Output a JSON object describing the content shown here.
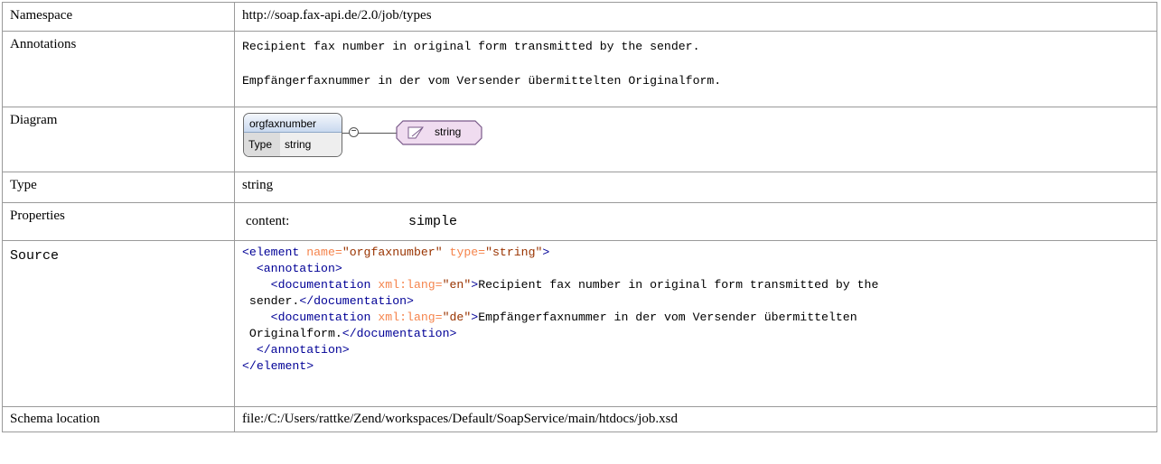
{
  "rows": {
    "namespace": {
      "label": "Namespace",
      "value": "http://soap.fax-api.de/2.0/job/types"
    },
    "annotations": {
      "label": "Annotations",
      "lines": [
        "Recipient fax number in original form transmitted by the sender.",
        "Empfängerfaxnummer in der vom Versender übermittelten Originalform."
      ]
    },
    "diagram": {
      "label": "Diagram",
      "element_name": "orgfaxnumber",
      "type_key": "Type",
      "type_value": "string",
      "connector_symbol": "−",
      "simple_type_name": "string",
      "colors": {
        "element_header": "#c9d9ef",
        "type_box_fill": "#f0dcf0",
        "type_box_border": "#7a5a8a"
      }
    },
    "type": {
      "label": "Type",
      "value": "string"
    },
    "properties": {
      "label": "Properties",
      "key": "content:",
      "value": "simple"
    },
    "source": {
      "label": "Source",
      "colors": {
        "tag": "#000096",
        "attribute": "#f5844c",
        "value": "#993300"
      },
      "line1": {
        "open": "<element",
        "a1": "name=",
        "v1": "\"orgfaxnumber\"",
        "a2": "type=",
        "v2": "\"string\"",
        "close": ">"
      },
      "line2": {
        "indent": "  ",
        "tag": "<annotation>"
      },
      "line3": {
        "indent": "    ",
        "open": "<documentation",
        "attr": "xml:lang=",
        "val": "\"en\"",
        "close": ">",
        "text": "Recipient fax number in original form transmitted by the"
      },
      "line4": {
        "text": " sender.",
        "endtag": "</documentation>"
      },
      "line5": {
        "indent": "    ",
        "open": "<documentation",
        "attr": "xml:lang=",
        "val": "\"de\"",
        "close": ">",
        "text": "Empfängerfaxnummer in der vom Versender übermittelten"
      },
      "line6": {
        "text": " Originalform.",
        "endtag": "</documentation>"
      },
      "line7": {
        "indent": "  ",
        "tag": "</annotation>"
      },
      "line8": {
        "tag": "</element>"
      }
    },
    "schema_location": {
      "label": "Schema location",
      "value": "file:/C:/Users/rattke/Zend/workspaces/Default/SoapService/main/htdocs/job.xsd"
    }
  }
}
